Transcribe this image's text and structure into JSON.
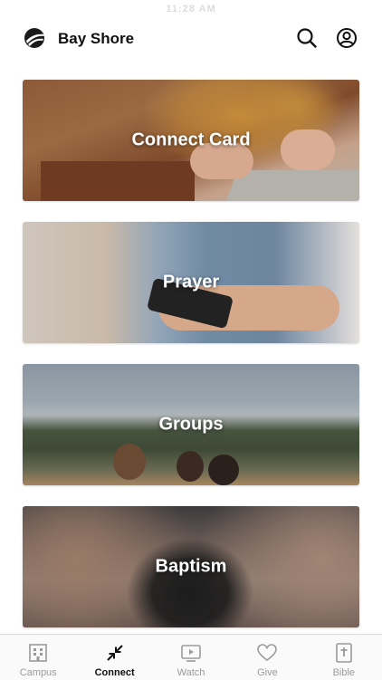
{
  "status_bar": {
    "time": "11:28 AM"
  },
  "header": {
    "title": "Bay Shore",
    "logo_icon": "church-logo-icon",
    "search_icon": "search-icon",
    "profile_icon": "profile-icon"
  },
  "cards": [
    {
      "label": "Connect Card"
    },
    {
      "label": "Prayer"
    },
    {
      "label": "Groups"
    },
    {
      "label": "Baptism"
    }
  ],
  "tabs": [
    {
      "label": "Campus",
      "icon": "building-icon",
      "active": false
    },
    {
      "label": "Connect",
      "icon": "connect-arrows-icon",
      "active": true
    },
    {
      "label": "Watch",
      "icon": "play-screen-icon",
      "active": false
    },
    {
      "label": "Give",
      "icon": "heart-icon",
      "active": false
    },
    {
      "label": "Bible",
      "icon": "bible-icon",
      "active": false
    }
  ],
  "colors": {
    "active_tab": "#111111",
    "inactive_tab": "#9a9a9a"
  }
}
